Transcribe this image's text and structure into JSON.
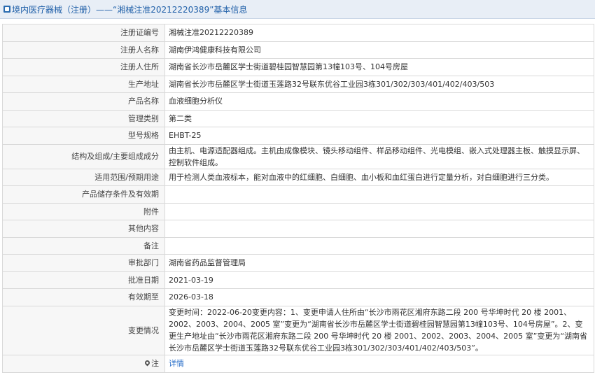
{
  "header": {
    "title": "境内医疗器械（注册）——“湘械注准20212220389”基本信息"
  },
  "rows": [
    {
      "label": "注册证编号",
      "value": "湘械注准20212220389"
    },
    {
      "label": "注册人名称",
      "value": "湖南伊鸿健康科技有限公司"
    },
    {
      "label": "注册人住所",
      "value": "湖南省长沙市岳麓区学士街道碧桂园智慧园第13幢103号、104号房屋"
    },
    {
      "label": "生产地址",
      "value": "湖南省长沙市岳麓区学士街道玉莲路32号联东优谷工业园3栋301/302/303/401/402/403/503"
    },
    {
      "label": "产品名称",
      "value": "血液细胞分析仪"
    },
    {
      "label": "管理类别",
      "value": "第二类"
    },
    {
      "label": "型号规格",
      "value": "EHBT-25"
    },
    {
      "label": "结构及组成/主要组成成分",
      "value": "由主机、电源适配器组成。主机由成像模块、镜头移动组件、样品移动组件、光电模组、嵌入式处理器主板、触摸显示屏、控制软件组成。"
    },
    {
      "label": "适用范围/预期用途",
      "value": "用于检测人类血液标本，能对血液中的红细胞、白细胞、血小板和血红蛋白进行定量分析，对白细胞进行三分类。"
    },
    {
      "label": "产品储存条件及有效期",
      "value": ""
    },
    {
      "label": "附件",
      "value": ""
    },
    {
      "label": "其他内容",
      "value": ""
    },
    {
      "label": "备注",
      "value": ""
    },
    {
      "label": "审批部门",
      "value": "湖南省药品监督管理局"
    },
    {
      "label": "批准日期",
      "value": "2021-03-19"
    },
    {
      "label": "有效期至",
      "value": "2026-03-18"
    },
    {
      "label": "变更情况",
      "value": "变更时间：2022-06-20变更内容：1、变更申请人住所由“长沙市雨花区湘府东路二段 200 号华坤时代 20 楼 2001、2002、2003、2004、2005 室”变更为“湖南省长沙市岳麓区学士街道碧桂园智慧园第13幢103号、104号房屋”。2、变更生产地址由“长沙市雨花区湘府东路二段 200 号华坤时代 20 楼 2001、2002、2003、2004、2005 室”变更为“湖南省长沙市岳麓区学士街道玉莲路32号联东优谷工业园3栋301/302/303/401/402/403/503”。"
    }
  ],
  "note_row": {
    "label": "注",
    "link_text": "详情"
  }
}
